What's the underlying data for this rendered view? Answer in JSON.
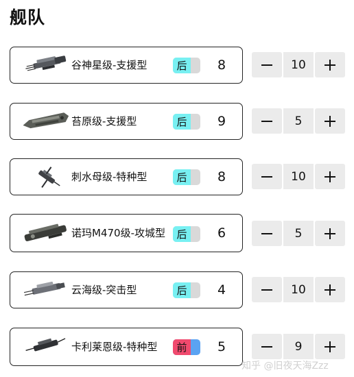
{
  "page": {
    "title": "舰队"
  },
  "fleet": [
    {
      "name": "谷神星级-支援型",
      "position": "后",
      "position_type": "back",
      "cost": "8",
      "quantity": "10",
      "icon": "ship-icon"
    },
    {
      "name": "苔原级-支援型",
      "position": "后",
      "position_type": "back",
      "cost": "9",
      "quantity": "5",
      "icon": "ship-icon"
    },
    {
      "name": "刺水母级-特种型",
      "position": "后",
      "position_type": "back",
      "cost": "8",
      "quantity": "10",
      "icon": "ship-icon"
    },
    {
      "name": "诺玛M470级-攻城型",
      "position": "后",
      "position_type": "back",
      "cost": "6",
      "quantity": "5",
      "icon": "ship-icon"
    },
    {
      "name": "云海级-突击型",
      "position": "后",
      "position_type": "back",
      "cost": "4",
      "quantity": "10",
      "icon": "ship-icon"
    },
    {
      "name": "卡利莱恩级-特种型",
      "position": "前",
      "position_type": "front",
      "cost": "5",
      "quantity": "9",
      "icon": "ship-icon"
    }
  ],
  "stepper": {
    "minus_symbol": "−",
    "plus_symbol": "+"
  },
  "colors": {
    "back_badge": "#78f0f2",
    "front_badge": "#f04a6e",
    "front_badge_alt": "#5aa3f2",
    "stepper_bg": "#ebebeb"
  },
  "watermark": "知乎 @旧夜天海Zzz"
}
